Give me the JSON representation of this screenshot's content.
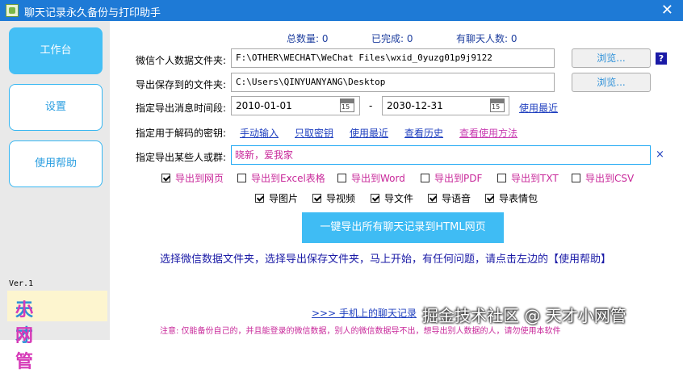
{
  "window": {
    "title": "聊天记录永久备份与打印助手"
  },
  "sidebar": {
    "items": [
      {
        "label": "工作台",
        "active": true
      },
      {
        "label": "设置",
        "active": false
      },
      {
        "label": "使用帮助",
        "active": false
      }
    ],
    "version": "Ver.1",
    "logo": {
      "part1": "天才",
      "part2": "小网管"
    }
  },
  "stats": {
    "total": "总数量: 0",
    "done": "已完成: 0",
    "contacts": "有聊天人数: 0"
  },
  "form": {
    "wechat_folder_label": "微信个人数据文件夹:",
    "wechat_folder_value": "F:\\OTHER\\WECHAT\\WeChat Files\\wxid_0yuzg01p9j9122",
    "browse_label": "浏览...",
    "help_mark": "?",
    "save_folder_label": "导出保存到的文件夹:",
    "save_folder_value": "C:\\Users\\QINYUANYANG\\Desktop",
    "time_range_label": "指定导出消息时间段:",
    "date_from": "2010-01-01",
    "date_sep": "-",
    "date_to": "2030-12-31",
    "calendar_day": "15",
    "use_recent_label": "使用最近",
    "key_label": "指定用于解码的密钥:",
    "key_links": [
      "手动输入",
      "只取密钥",
      "使用最近",
      "查看历史",
      "查看使用方法"
    ],
    "target_label": "指定导出某些人或群:",
    "target_value": "晓新，爱我家",
    "clear_label": "×"
  },
  "export_formats": [
    {
      "label": "导出到网页",
      "checked": true
    },
    {
      "label": "导出到Excel表格",
      "checked": false
    },
    {
      "label": "导出到Word",
      "checked": false
    },
    {
      "label": "导出到PDF",
      "checked": false
    },
    {
      "label": "导出到TXT",
      "checked": false
    },
    {
      "label": "导出到CSV",
      "checked": false
    }
  ],
  "media_options": [
    {
      "label": "导图片",
      "checked": true
    },
    {
      "label": "导视频",
      "checked": true
    },
    {
      "label": "导文件",
      "checked": true
    },
    {
      "label": "导语音",
      "checked": true
    },
    {
      "label": "导表情包",
      "checked": true
    }
  ],
  "export_button": "一键导出所有聊天记录到HTML网页",
  "hint": "选择微信数据文件夹，选择导出保存文件夹，马上开始，有任何问题，请点击左边的【使用帮助】",
  "mobile_link": ">>>  手机上的聊天记录",
  "watermark": "掘金技术社区 @ 天才小网管",
  "note": "注意: 仅能备份自己的，并且能登录的微信数据，别人的微信数据导不出，想导出别人数据的人，请勿使用本软件",
  "colors": {
    "accent": "#44bff5",
    "title_bar": "#1e7ad6",
    "link": "#1f3fbf",
    "pink": "#c8289a"
  }
}
